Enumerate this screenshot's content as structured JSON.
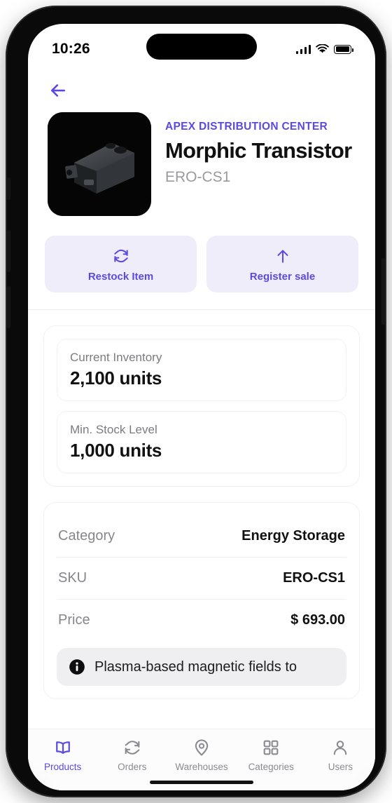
{
  "status_bar": {
    "time": "10:26",
    "cellular_icon": "signal-bars-icon",
    "wifi_icon": "wifi-icon",
    "battery_icon": "battery-full-icon"
  },
  "nav": {
    "back_icon": "back-arrow-icon"
  },
  "product": {
    "image_alt": "industrial-component-render",
    "vendor": "APEX DISTRIBUTION CENTER",
    "name": "Morphic Transistor",
    "sku_subtitle": "ERO-CS1"
  },
  "actions": [
    {
      "label": "Restock Item",
      "icon": "refresh-icon"
    },
    {
      "label": "Register sale",
      "icon": "arrow-up-icon"
    }
  ],
  "inventory": [
    {
      "label": "Current Inventory",
      "value": "2,100 units"
    },
    {
      "label": "Min. Stock Level",
      "value": "1,000 units"
    }
  ],
  "details": [
    {
      "key": "Category",
      "value": "Energy Storage"
    },
    {
      "key": "SKU",
      "value": "ERO-CS1"
    },
    {
      "key": "Price",
      "value": "$ 693.00"
    }
  ],
  "info_note": {
    "icon": "info-circle-icon",
    "text": "Plasma-based magnetic fields to"
  },
  "tabbar": [
    {
      "label": "Products",
      "icon": "book-icon",
      "active": true
    },
    {
      "label": "Orders",
      "icon": "refresh-icon",
      "active": false
    },
    {
      "label": "Warehouses",
      "icon": "map-pin-icon",
      "active": false
    },
    {
      "label": "Categories",
      "icon": "grid-icon",
      "active": false
    },
    {
      "label": "Users",
      "icon": "user-icon",
      "active": false
    }
  ],
  "colors": {
    "accent": "#5a4ae3",
    "accent_soft": "#f0edfa",
    "text_primary": "#111111",
    "text_muted": "#86868b",
    "info_bg": "#efeff1"
  }
}
